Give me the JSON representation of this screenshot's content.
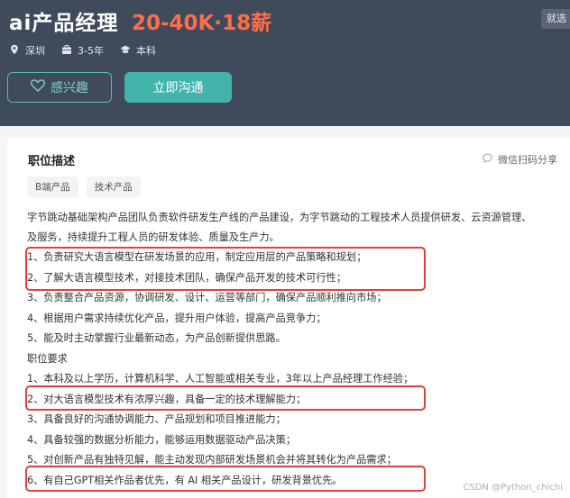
{
  "header": {
    "job_title": "ai产品经理",
    "salary": "20-40K·18薪",
    "badge": "就选",
    "meta": {
      "city": "深圳",
      "experience": "3-5年",
      "education": "本科"
    },
    "interest_label": "感兴趣",
    "chat_label": "立即沟通",
    "accent_color": "#42b4ab"
  },
  "card": {
    "title": "职位描述",
    "share_label": "微信扫码分享",
    "tags": [
      "B端产品",
      "技术产品"
    ],
    "intro_line1": "字节跳动基础架构产品团队负责软件研发生产线的产品建设，为字节跳动的工程技术人员提供研发、云资源管理、",
    "intro_line2": "及服务，持续提升工程人员的研发体验、质量及生产力。",
    "duties": [
      "1、负责研究大语言模型在研发场景的应用，制定应用层的产品策略和规划；",
      "2、了解大语言模型技术，对接技术团队，确保产品开发的技术可行性；",
      "3、负责整合产品资源，协调研发、设计、运营等部门，确保产品顺利推向市场；",
      "4、根据用户需求持续优化产品，提升用户体验，提高产品竞争力；",
      "5、能及时主动掌握行业最新动态，为产品创新提供思路。"
    ],
    "requirements_title": "职位要求",
    "requirements": [
      "1、本科及以上学历，计算机科学、人工智能或相关专业，3年以上产品经理工作经验；",
      "2、对大语言模型技术有浓厚兴趣，具备一定的技术理解能力；",
      "3、具备良好的沟通协调能力、产品规划和项目推进能力；",
      "4、具备较强的数据分析能力，能够运用数据驱动产品决策；",
      "5、对创新产品有独特见解，能主动发现内部研发场景机会并将其转化为产品需求；",
      "6、有自己GPT相关作品者优先，有 AI 相关产品设计，研发背景优先。"
    ],
    "highlight_color": "#e0413a"
  },
  "watermark": "CSDN @Python_chichi"
}
